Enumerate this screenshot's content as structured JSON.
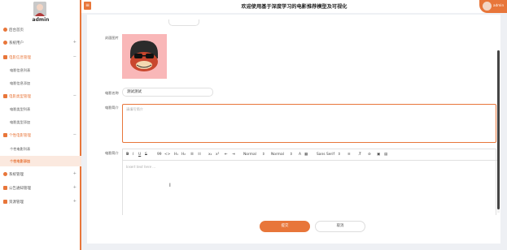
{
  "app": {
    "title": "欢迎使用基于深度学习的电影推荐模型及可视化"
  },
  "user": {
    "name": "admin",
    "top_name": "admin"
  },
  "sidebar": {
    "items": [
      {
        "label": "后台首页",
        "arrow": ""
      },
      {
        "label": "系统用户",
        "arrow": "+"
      },
      {
        "label": "电影信息管理",
        "arrow": "−"
      },
      {
        "label": "电影信息列表"
      },
      {
        "label": "电影信息添加"
      },
      {
        "label": "电影类型管理",
        "arrow": "−"
      },
      {
        "label": "电影类型列表"
      },
      {
        "label": "电影类型添加"
      },
      {
        "label": "个性电影管理",
        "arrow": "−"
      },
      {
        "label": "个性电影列表"
      },
      {
        "label": "个性电影添加"
      },
      {
        "label": "系统管理",
        "arrow": "+"
      },
      {
        "label": "公告通知管理",
        "arrow": "+"
      },
      {
        "label": "资源管理",
        "arrow": "+"
      }
    ]
  },
  "form": {
    "cover_label": "封面图片",
    "name_label": "电影名称",
    "name_value": "测试测试",
    "desc_label": "电影简介",
    "desc_placeholder": "请填写简介",
    "detail_label": "电影简介",
    "editor_placeholder": "Insert text here ...",
    "toolbar": {
      "bold": "B",
      "italic": "I",
      "underline": "U",
      "strike": "S",
      "quote": "99",
      "code": "<>",
      "h1": "H₁",
      "h2": "H₂",
      "sub": "x₂",
      "sup": "x²",
      "indent": "⇤",
      "outdent": "⇥",
      "size1": "Normal",
      "size2": "Normal",
      "font": "Sans Serif",
      "color": "A"
    },
    "submit_label": "提交",
    "cancel_label": "取消"
  }
}
